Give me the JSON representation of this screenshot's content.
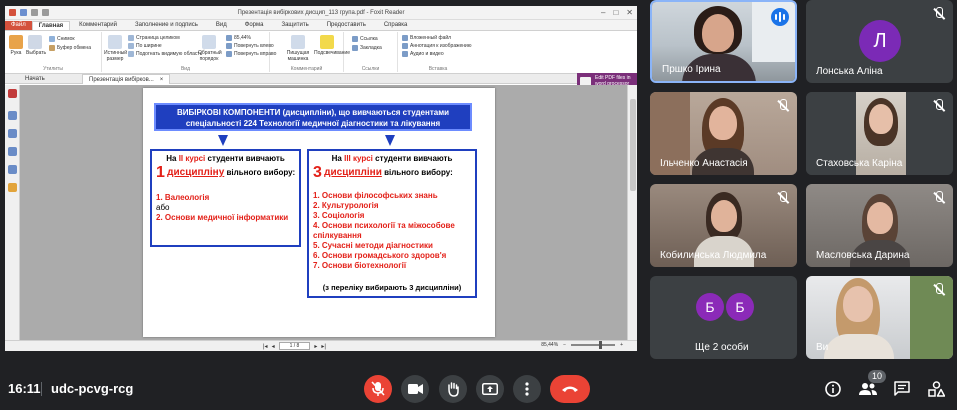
{
  "presentation": {
    "window_title": "Презентація вибіркових дисцип_113 група.pdf - Foxit Reader",
    "menu": [
      "Файл",
      "Главная",
      "Комментарий",
      "Заполнение и подпись",
      "Вид",
      "Форма",
      "Защитить",
      "Предоставить",
      "Справка"
    ],
    "menu_active_index": 1,
    "ribbon": {
      "hand": "Рука",
      "select": "Выбрать",
      "snapshot": "Снимок",
      "clipboard": "Буфер обмена",
      "actual_size": "Истинный размер",
      "fit_page": "Страница целиком",
      "fit_width": "По ширине",
      "fit_visible": "Подогнать видимую область",
      "reflow": "Обратный порядок",
      "zoom": "85,44%",
      "rotate_left": "Повернуть влево",
      "rotate_right": "Повернуть вправо",
      "typewriter": "Пишущая машинка",
      "highlight": "Подсвечивание",
      "link": "Ссылка",
      "bookmark": "Закладка",
      "file_attach": "Вложенный файл",
      "image_annot": "Аннотация к изображению",
      "audio_video": "Аудио и видео",
      "groups": [
        "Утилиты",
        "Вид",
        "Комментарий",
        "Ссылки",
        "Вставка"
      ]
    },
    "doc_tabs": [
      "Начать",
      "Презентація вибірков..."
    ],
    "promo": "Edit PDF files in word processor",
    "page_field": "1 / 8",
    "status_zoom": "85,44%"
  },
  "slide": {
    "header": "ВИБІРКОВІ КОМПОНЕНТИ (дисципліни), що вивчаються студентами спеціальності 224 Технології медичної діагностики та лікування",
    "left": {
      "head_pre": "На ",
      "head_red": "ІІ курсі",
      "head_post": " студенти вивчають",
      "num": "1",
      "word": "дисципліну",
      "sub_post": " вільного вибору:",
      "item1": "1. Валеологія",
      "conj": "або",
      "item2": "2. Основи медичної інформатики"
    },
    "right": {
      "head_pre": "На ",
      "head_red": "ІІІ курсі",
      "head_post": " студенти вивчають",
      "num": "3",
      "word": "дисципліни",
      "sub_post": " вільного вибору:",
      "items": [
        "1. Основи філософських знань",
        "2. Культурологія",
        "3. Соціологія",
        "4. Основи психології та міжособове спілкування",
        "5. Сучасні методи діагностики",
        "6. Основи громадського здоров'я",
        "7. Основи біотехнології"
      ],
      "footer": "(з переліку вибирають 3 дисципліни)"
    }
  },
  "participants": [
    {
      "name": "Пршко Ірина",
      "speaking": true
    },
    {
      "name": "Лонська Аліна",
      "initial": "Л",
      "avatar_color": "#7b2ab6"
    },
    {
      "name": "Ільченко Анастасія"
    },
    {
      "name": "Стаховська Каріна"
    },
    {
      "name": "Кобилинська Людмила"
    },
    {
      "name": "Масловська Дарина"
    },
    {
      "name": "Ще 2 особи",
      "initials": [
        "Б",
        "Б"
      ],
      "avatar_color": "#8b2ab8"
    },
    {
      "name": "Ви"
    }
  ],
  "bottom": {
    "time": "16:11",
    "meeting_code": "udc-pcvg-rcg",
    "people_count": "10"
  },
  "colors": {
    "end_call": "#ea4335",
    "slide_blue": "#1f3fbf",
    "slide_red": "#e32018"
  }
}
